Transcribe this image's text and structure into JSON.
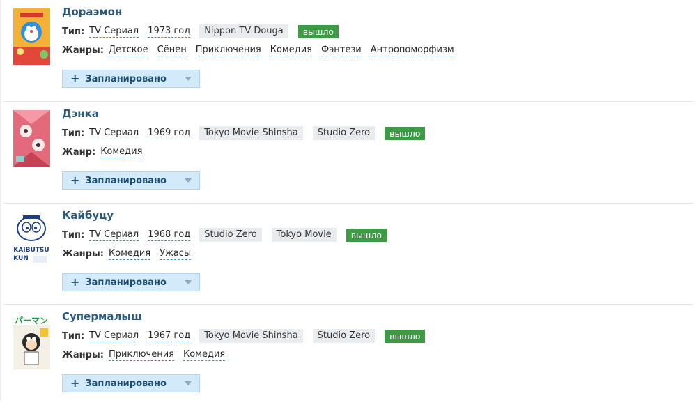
{
  "labels": {
    "type": "Тип:",
    "genres_plural": "Жанры:",
    "genre_singular": "Жанр:",
    "plan_button": "Запланировано",
    "plan_plus": "+"
  },
  "colors": {
    "title": "#2b5a7a",
    "status_bg": "#3d9b45",
    "plan_bg": "#d3eafa",
    "chip_bg": "#e9ecef",
    "link_underline": "#4a8ab8"
  },
  "entries": [
    {
      "title": "Дораэмон",
      "type": "TV Сериал",
      "year": "1973 год",
      "studios": [
        "Nippon TV Douga"
      ],
      "status": "вышло",
      "genre_label": "Жанры:",
      "genres": [
        "Детское",
        "Сёнен",
        "Приключения",
        "Комедия",
        "Фэнтези",
        "Антропоморфизм"
      ],
      "poster_icon": "doraemon-poster"
    },
    {
      "title": "Дэнка",
      "type": "TV Сериал",
      "year": "1969 год",
      "studios": [
        "Tokyo Movie Shinsha",
        "Studio Zero"
      ],
      "status": "вышло",
      "genre_label": "Жанр:",
      "genres": [
        "Комедия"
      ],
      "poster_icon": "denka-poster"
    },
    {
      "title": "Кайбуцу",
      "type": "TV Сериал",
      "year": "1968 год",
      "studios": [
        "Studio Zero",
        "Tokyo Movie"
      ],
      "status": "вышло",
      "genre_label": "Жанры:",
      "genres": [
        "Комедия",
        "Ужасы"
      ],
      "poster_icon": "kaibutsu-poster",
      "poster_text": [
        "KAIBUTSU",
        "KUN"
      ]
    },
    {
      "title": "Супермалыш",
      "type": "TV Сериал",
      "year": "1967 год",
      "studios": [
        "Tokyo Movie Shinsha",
        "Studio Zero"
      ],
      "status": "вышло",
      "genre_label": "Жанры:",
      "genres": [
        "Приключения",
        "Комедия"
      ],
      "poster_icon": "perman-poster",
      "poster_text": [
        "パーマン"
      ]
    }
  ]
}
